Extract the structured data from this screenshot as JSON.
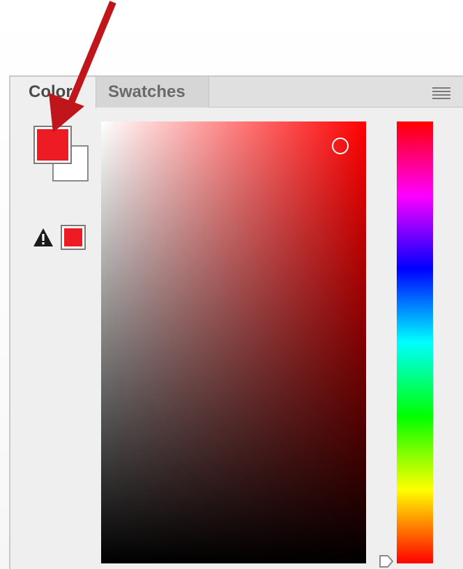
{
  "panel": {
    "tabs": [
      {
        "label": "Color",
        "active": true
      },
      {
        "label": "Swatches",
        "active": false
      }
    ],
    "menu_icon": "panel-menu-icon"
  },
  "color_picker": {
    "foreground_color": "#ed1c24",
    "background_color": "#ffffff",
    "out_of_gamut_color": "#ed1c24",
    "hue": "#ff0000",
    "icons": {
      "warning": "out-of-gamut-warning-icon",
      "hue_slider": "hue-slider-arrow"
    }
  },
  "annotation": {
    "arrow_color": "#c0151b"
  }
}
